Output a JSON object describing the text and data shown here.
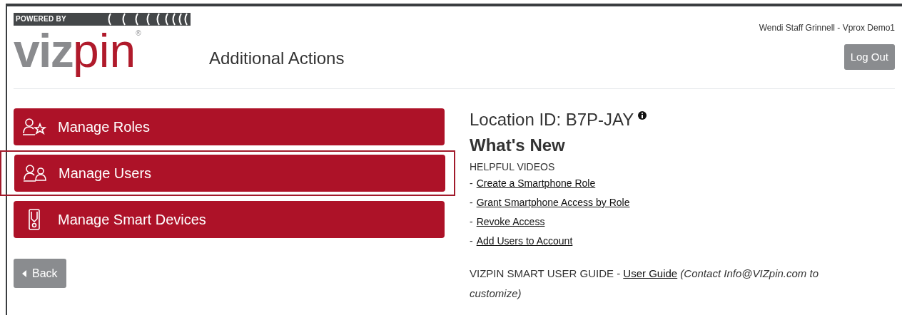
{
  "logo": {
    "tagline": "POWERED BY",
    "word_gray": "viz",
    "word_red": "pin",
    "mark": "®"
  },
  "page_title": "Additional Actions",
  "user": "Wendi Staff Grinnell - Vprox Demo1",
  "logout": "Log Out",
  "actions": [
    {
      "label": "Manage Roles",
      "kind": "roles",
      "highlighted": false
    },
    {
      "label": "Manage Users",
      "kind": "users",
      "highlighted": true
    },
    {
      "label": "Manage Smart Devices",
      "kind": "device",
      "highlighted": false
    }
  ],
  "back": "Back",
  "location": "Location ID: B7P-JAY",
  "whats_new": "What's New",
  "videos_heading": "HELPFUL VIDEOS",
  "videos": [
    {
      "dash": "-",
      "link": "Create a Smartphone Role"
    },
    {
      "dash": "-",
      "link": "Grant Smartphone Access by Role"
    },
    {
      "dash": "-",
      "link": "Revoke Access"
    },
    {
      "dash": "-",
      "link": "Add Users to Account"
    }
  ],
  "guide": {
    "prefix": "VIZPIN SMART USER GUIDE - ",
    "link": "User Guide",
    "note": "(Contact Info@VIZpin.com to customize)"
  }
}
